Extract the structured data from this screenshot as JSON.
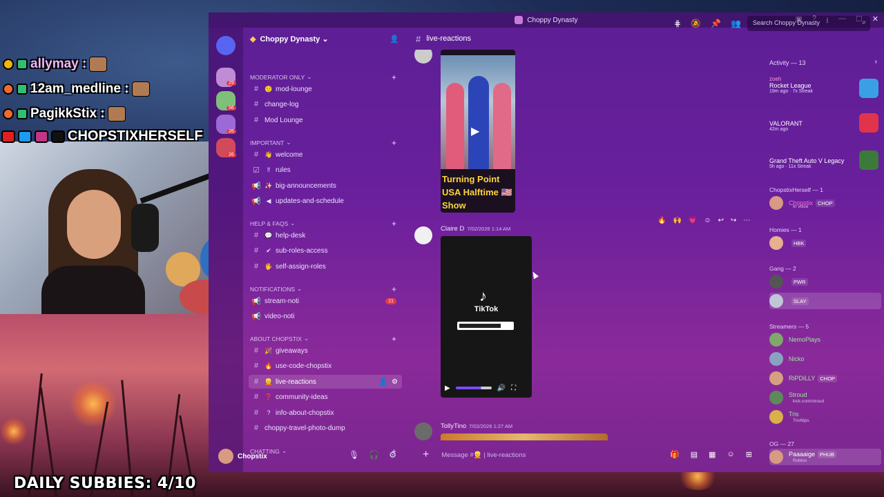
{
  "overlay": {
    "chat": [
      {
        "user": "allymay :"
      },
      {
        "user": "12am_medline :"
      },
      {
        "user": "PagikkStix :"
      }
    ],
    "socials_handle": "CHOPSTIXHERSELF",
    "subbies": "DAILY SUBBIES: 4/10"
  },
  "window": {
    "title": "Choppy Dynasty",
    "controls": {
      "minimize": "—",
      "maximize": "☐",
      "close": "✕"
    }
  },
  "rail_badges": [
    "29",
    "56",
    "26",
    "26"
  ],
  "server": {
    "name": "Choppy Dynasty ⌄"
  },
  "categories": [
    {
      "label": "MODERATOR ONLY",
      "channels": [
        {
          "emoji": "🙂",
          "name": "mod-lounge"
        },
        {
          "emoji": "•",
          "name": "change-log"
        },
        {
          "emoji": "",
          "name": "Mod Lounge"
        }
      ]
    },
    {
      "label": "IMPORTANT",
      "channels": [
        {
          "emoji": "👋",
          "name": "welcome"
        },
        {
          "emoji": "‼",
          "name": "rules"
        },
        {
          "emoji": "✨",
          "name": "big-announcements"
        },
        {
          "emoji": "◀",
          "name": "updates-and-schedule"
        }
      ]
    },
    {
      "label": "HELP & FAQS",
      "channels": [
        {
          "emoji": "💬",
          "name": "help-desk"
        },
        {
          "emoji": "✔",
          "name": "sub-roles-access"
        },
        {
          "emoji": "🖐",
          "name": "self-assign-roles"
        }
      ]
    },
    {
      "label": "NOTIFICATIONS",
      "channels": [
        {
          "emoji": "",
          "name": "stream-noti",
          "badge": "21"
        },
        {
          "emoji": "",
          "name": "video-noti"
        }
      ]
    },
    {
      "label": "ABOUT CHOPSTIX",
      "channels": [
        {
          "emoji": "🎉",
          "name": "giveaways"
        },
        {
          "emoji": "🔥",
          "name": "use-code-chopstix"
        },
        {
          "emoji": "👱",
          "name": "live-reactions",
          "active": true
        },
        {
          "emoji": "❓",
          "name": "community-ideas"
        },
        {
          "emoji": "?",
          "name": "info-about-chopstix"
        },
        {
          "emoji": "",
          "name": "choppy-travel-photo-dump"
        }
      ]
    },
    {
      "label": "CHATTING",
      "channels": []
    }
  ],
  "user": {
    "name": "Chopstix"
  },
  "header": {
    "channel": "live-reactions",
    "search_placeholder": "Search Choppy Dynasty"
  },
  "messages": [
    {
      "author": "",
      "time": "",
      "caption": "Turning Point USA Halftime 🇺🇸 Show"
    },
    {
      "author": "Claire D",
      "time": "7/02/2026 1:14 AM",
      "video_brand": "TikTok"
    },
    {
      "author": "TollyTino",
      "time": "7/02/2026 1:27 AM"
    }
  ],
  "composer": {
    "placeholder": "Message #👱 | live-reactions"
  },
  "members": {
    "activity_header": "Activity — 13",
    "activities": [
      {
        "user": "zoeh",
        "game": "Rocket League",
        "meta": "19m ago · 7x Streak",
        "icon_color": "#3aa0e6"
      },
      {
        "user": "",
        "game": "VALORANT",
        "meta": "42m ago",
        "icon_color": "#e0344b"
      },
      {
        "user": "",
        "game": "Grand Theft Auto V Legacy",
        "meta": "5h ago · 11x Streak",
        "icon_color": "#3b7a3b"
      }
    ],
    "groups": [
      {
        "label": "ChopstixHerself — 1",
        "members": [
          {
            "name": "Chopstix",
            "tag": "CHOP",
            "sub": "In voice",
            "color": "#ff6bd6"
          }
        ]
      },
      {
        "label": "Homies — 1",
        "members": [
          {
            "name": "",
            "tag": "HBK",
            "sub": "",
            "color": "#ff4f7a"
          }
        ]
      },
      {
        "label": "Gang — 2",
        "members": [
          {
            "name": "",
            "tag": "PWR",
            "sub": "",
            "color": "#6fa0ff"
          },
          {
            "name": "",
            "tag": "SLAY",
            "sub": "",
            "color": "#6fa0ff"
          }
        ]
      },
      {
        "label": "Streamers — 5",
        "members": [
          {
            "name": "NemoPlays",
            "tag": "",
            "sub": "",
            "color": "#9ae6a0"
          },
          {
            "name": "Nicko",
            "tag": "",
            "sub": "",
            "color": "#9ae6a0"
          },
          {
            "name": "RiPDiLLY",
            "tag": "CHOP",
            "sub": "",
            "color": "#9ae6a0"
          },
          {
            "name": "Stroud",
            "tag": "",
            "sub": "kick.com/stroud",
            "color": "#9ae6a0"
          },
          {
            "name": "Tris",
            "tag": "",
            "sub": "TrisNips",
            "color": "#9ae6a0"
          }
        ]
      },
      {
        "label": "OG — 27",
        "members": [
          {
            "name": "Paaaaige",
            "tag": "PHUB",
            "sub": "Roblox",
            "color": "#ffffff"
          }
        ]
      }
    ]
  },
  "colors": {
    "discord_bg": "#6a1f9c",
    "accent": "#e23a46"
  }
}
